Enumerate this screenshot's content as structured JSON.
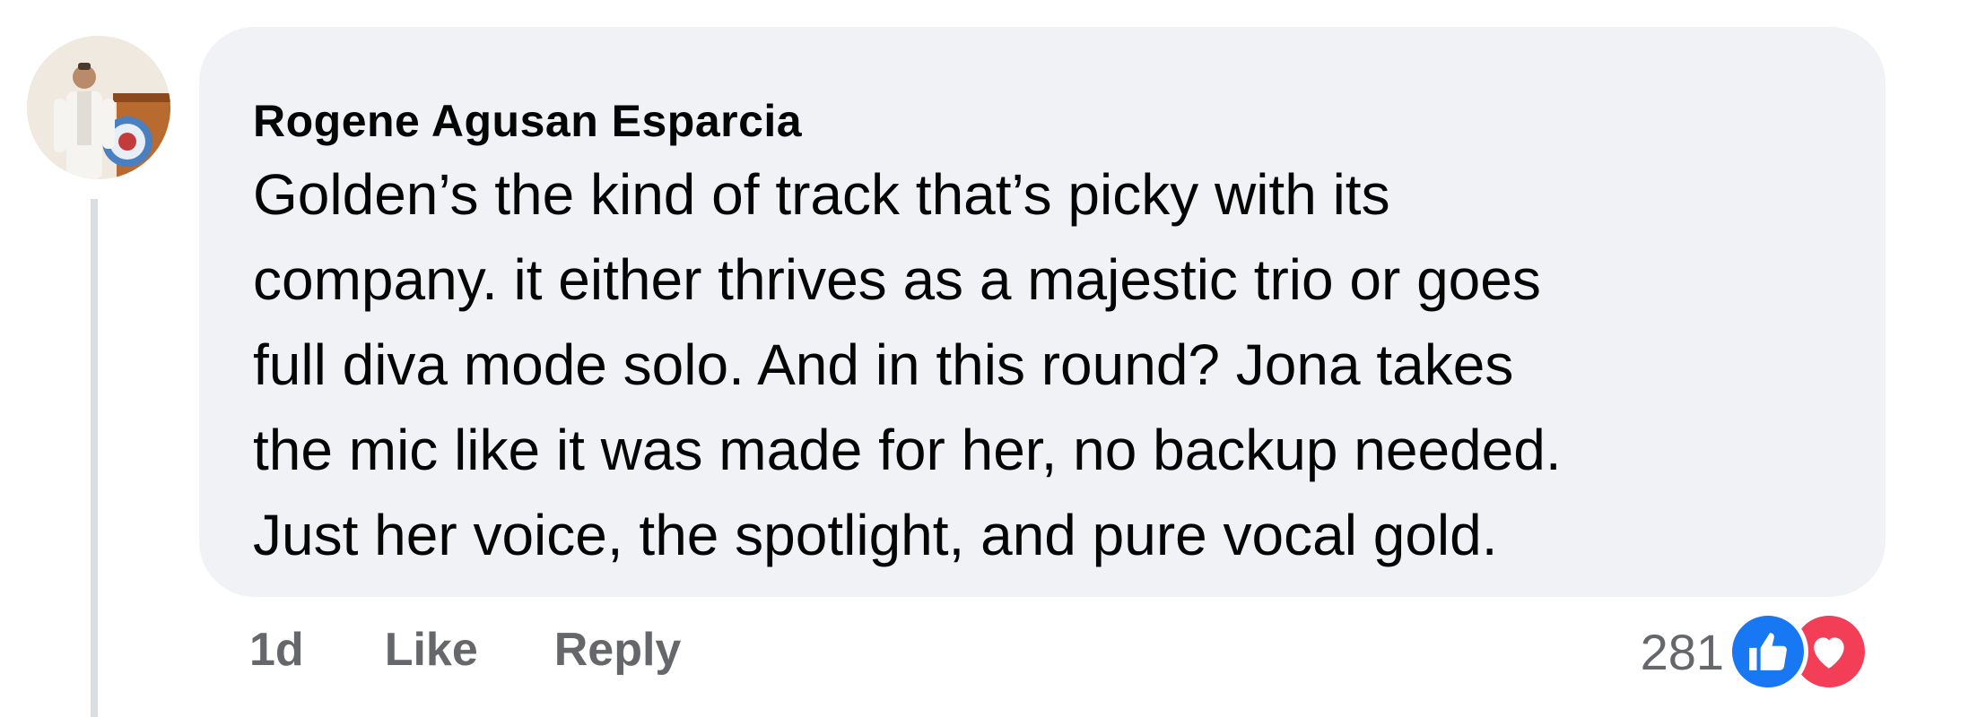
{
  "comment": {
    "author": "Rogene Agusan Esparcia",
    "text": "Golden’s the kind of track that’s picky with its\ncompany. it either thrives as a majestic trio or goes\nfull diva mode solo. And in this round? Jona takes\nthe mic like it was made for her, no backup needed.\nJust her voice, the spotlight, and pure vocal gold.",
    "timestamp": "1d",
    "like_label": "Like",
    "reply_label": "Reply",
    "reaction_count": "281",
    "reaction_icons": [
      "like-icon",
      "love-icon"
    ]
  },
  "colors": {
    "bubble_bg": "#f0f2f5",
    "text": "#050505",
    "secondary_text": "#65676b",
    "like_blue": "#1877f2",
    "love_red": "#f33e58",
    "thread_line": "#dadde1"
  }
}
